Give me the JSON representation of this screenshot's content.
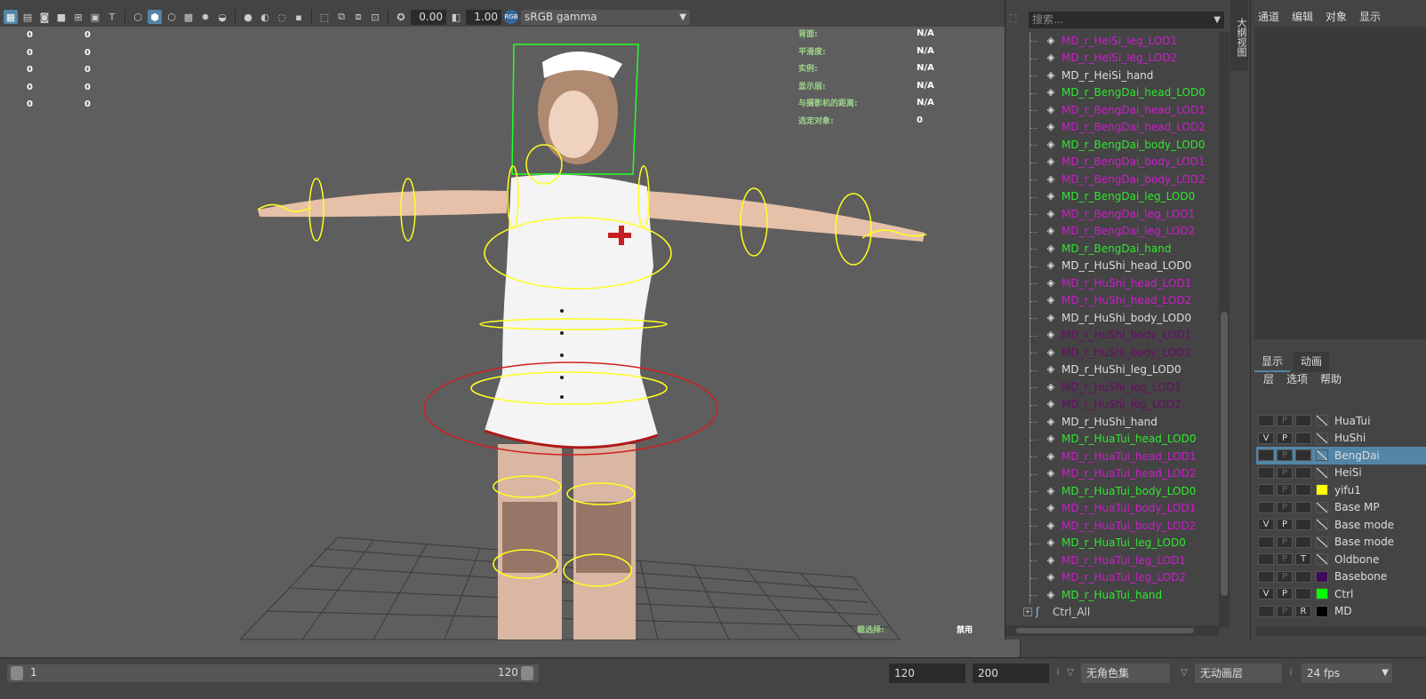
{
  "viewport": {
    "toolbar": {
      "exposure_value": "0.00",
      "gamma_value": "1.00",
      "color_space_badge": "RGB",
      "color_space": "sRGB gamma"
    },
    "hud_left": [
      [
        "0",
        "0"
      ],
      [
        "0",
        "0"
      ],
      [
        "0",
        "0"
      ],
      [
        "0",
        "0"
      ],
      [
        "0",
        "0"
      ]
    ],
    "hud_right": [
      {
        "label": "背面:",
        "value": "N/A"
      },
      {
        "label": "平滑度:",
        "value": "N/A"
      },
      {
        "label": "实例:",
        "value": "N/A"
      },
      {
        "label": "显示层:",
        "value": "N/A"
      },
      {
        "label": "与摄影机的距离:",
        "value": "N/A"
      },
      {
        "label": "选定对象:",
        "value": "0"
      }
    ],
    "hud_bottom_label": "载选择:",
    "hud_bottom_value": "禁用"
  },
  "outliner": {
    "search_placeholder": "搜索...",
    "items": [
      {
        "label": "MD_r_HeiSi_leg_LOD1",
        "color": "#d01ad0"
      },
      {
        "label": "MD_r_HeiSi_leg_LOD2",
        "color": "#d01ad0"
      },
      {
        "label": "MD_r_HeiSi_hand",
        "color": "#dddddd"
      },
      {
        "label": "MD_r_BengDai_head_LOD0",
        "color": "#2ee82e"
      },
      {
        "label": "MD_r_BengDai_head_LOD1",
        "color": "#d01ad0"
      },
      {
        "label": "MD_r_BengDai_head_LOD2",
        "color": "#d01ad0"
      },
      {
        "label": "MD_r_BengDai_body_LOD0",
        "color": "#2ee82e"
      },
      {
        "label": "MD_r_BengDai_body_LOD1",
        "color": "#d01ad0"
      },
      {
        "label": "MD_r_BengDai_body_LOD2",
        "color": "#d01ad0"
      },
      {
        "label": "MD_r_BengDai_leg_LOD0",
        "color": "#2ee82e"
      },
      {
        "label": "MD_r_BengDai_leg_LOD1",
        "color": "#d01ad0"
      },
      {
        "label": "MD_r_BengDai_leg_LOD2",
        "color": "#d01ad0"
      },
      {
        "label": "MD_r_BengDai_hand",
        "color": "#2ee82e"
      },
      {
        "label": "MD_r_HuShi_head_LOD0",
        "color": "#dddddd"
      },
      {
        "label": "MD_r_HuShi_head_LOD1",
        "color": "#d01ad0"
      },
      {
        "label": "MD_r_HuShi_head_LOD2",
        "color": "#d01ad0"
      },
      {
        "label": "MD_r_HuShi_body_LOD0",
        "color": "#dddddd"
      },
      {
        "label": "MD_r_HuShi_body_LOD1",
        "color": "#6a0a6a"
      },
      {
        "label": "MD_r_HuShi_body_LOD2",
        "color": "#6a0a6a"
      },
      {
        "label": "MD_r_HuShi_leg_LOD0",
        "color": "#dddddd"
      },
      {
        "label": "MD_r_HuShi_leg_LOD1",
        "color": "#6a0a6a"
      },
      {
        "label": "MD_r_HuShi_leg_LOD2",
        "color": "#6a0a6a"
      },
      {
        "label": "MD_r_HuShi_hand",
        "color": "#dddddd"
      },
      {
        "label": "MD_r_HuaTui_head_LOD0",
        "color": "#2ee82e"
      },
      {
        "label": "MD_r_HuaTui_head_LOD1",
        "color": "#d01ad0"
      },
      {
        "label": "MD_r_HuaTui_head_LOD2",
        "color": "#d01ad0"
      },
      {
        "label": "MD_r_HuaTui_body_LOD0",
        "color": "#2ee82e"
      },
      {
        "label": "MD_r_HuaTui_body_LOD1",
        "color": "#d01ad0"
      },
      {
        "label": "MD_r_HuaTui_body_LOD2",
        "color": "#d01ad0"
      },
      {
        "label": "MD_r_HuaTui_leg_LOD0",
        "color": "#2ee82e"
      },
      {
        "label": "MD_r_HuaTui_leg_LOD1",
        "color": "#d01ad0"
      },
      {
        "label": "MD_r_HuaTui_leg_LOD2",
        "color": "#d01ad0"
      },
      {
        "label": "MD_r_HuaTui_hand",
        "color": "#2ee82e"
      }
    ],
    "group_item": "Ctrl_All"
  },
  "side_tab": "大纲视图",
  "channel_box": {
    "menu": [
      "通道",
      "编辑",
      "对象",
      "显示"
    ],
    "tabs": [
      "显示",
      "动画"
    ],
    "layer_menu": [
      "层",
      "选项",
      "帮助"
    ],
    "layers": [
      {
        "v": "",
        "p": "P",
        "t": "",
        "swatch": "",
        "name": "HuaTui",
        "selected": false
      },
      {
        "v": "V",
        "p": "P",
        "t": "",
        "swatch": "",
        "name": "HuShi",
        "selected": false
      },
      {
        "v": "",
        "p": "P",
        "t": "",
        "swatch": "",
        "name": "BengDai",
        "selected": true
      },
      {
        "v": "",
        "p": "P",
        "t": "",
        "swatch": "",
        "name": "HeiSi",
        "selected": false
      },
      {
        "v": "",
        "p": "P",
        "t": "",
        "swatch": "#ffff00",
        "name": "yifu1",
        "selected": false
      },
      {
        "v": "",
        "p": "P",
        "t": "",
        "swatch": "",
        "name": "Base MP",
        "selected": false
      },
      {
        "v": "V",
        "p": "P",
        "t": "",
        "swatch": "",
        "name": "Base mode",
        "selected": false
      },
      {
        "v": "",
        "p": "P",
        "t": "",
        "swatch": "",
        "name": "Base mode",
        "selected": false
      },
      {
        "v": "",
        "p": "P",
        "t": "T",
        "swatch": "",
        "name": "Oldbone",
        "selected": false
      },
      {
        "v": "",
        "p": "P",
        "t": "",
        "swatch": "#3d0a5c",
        "name": "Basebone",
        "selected": false
      },
      {
        "v": "V",
        "p": "P",
        "t": "",
        "swatch": "#00ff00",
        "name": "Ctrl",
        "selected": false
      },
      {
        "v": "",
        "p": "P",
        "t": "R",
        "swatch": "#000000",
        "name": "MD",
        "selected": false
      }
    ]
  },
  "timebar": {
    "range_start": "1",
    "range_end": "120",
    "end_time": "120",
    "anim_end": "200",
    "char_set": "无角色集",
    "anim_layer": "无动画层",
    "fps": "24 fps"
  }
}
